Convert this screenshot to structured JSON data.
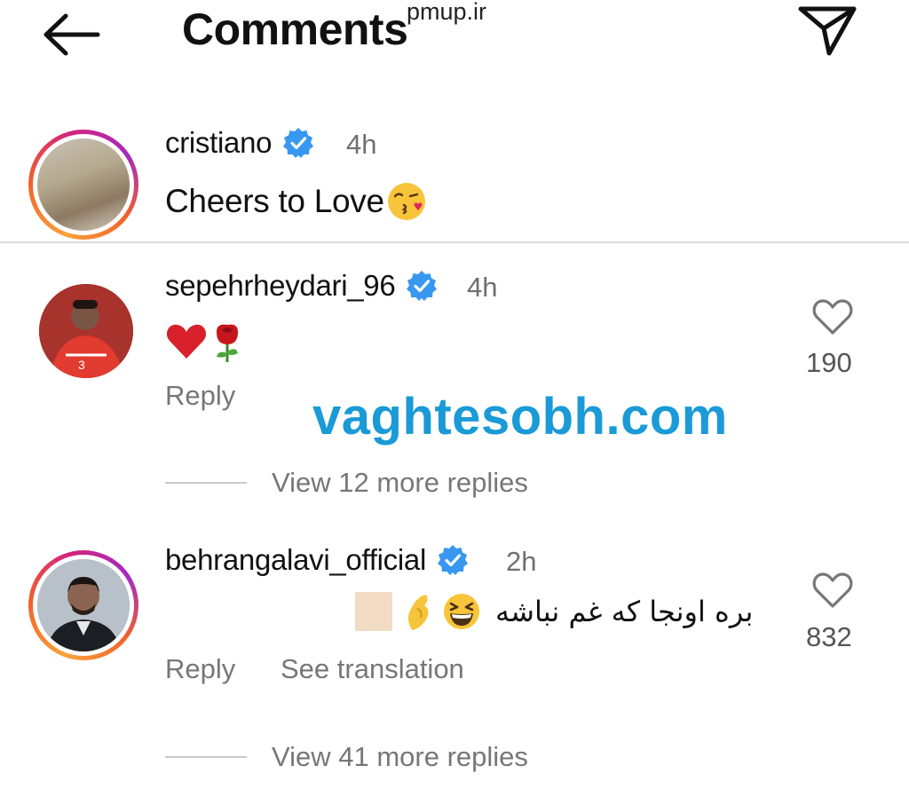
{
  "header": {
    "title": "Comments",
    "watermark": "pmup.ir",
    "back_icon": "arrow-left-icon",
    "send_icon": "paper-plane-icon"
  },
  "colors": {
    "verified_blue": "#3897f0",
    "watermark_blue": "#1a9ad6",
    "muted_text": "#777777"
  },
  "caption": {
    "username": "cristiano",
    "time": "4h",
    "text": "Cheers to Love",
    "emoji": "face-blowing-kiss"
  },
  "comments": [
    {
      "username": "sepehrheydari_96",
      "time": "4h",
      "emojis": [
        "red-heart",
        "rose"
      ],
      "reply_label": "Reply",
      "like_count": "190",
      "view_replies": "View 12 more replies"
    },
    {
      "username": "behrangalavi_official",
      "time": "2h",
      "text": "بره اونجا که غم نباشه",
      "emojis": [
        "grinning-squinting-face",
        "pinched-fingers",
        "unsupported-glyph"
      ],
      "reply_label": "Reply",
      "translate_label": "See translation",
      "like_count": "832",
      "view_replies": "View 41 more replies"
    }
  ],
  "watermark_center": "vaghtesobh.com"
}
